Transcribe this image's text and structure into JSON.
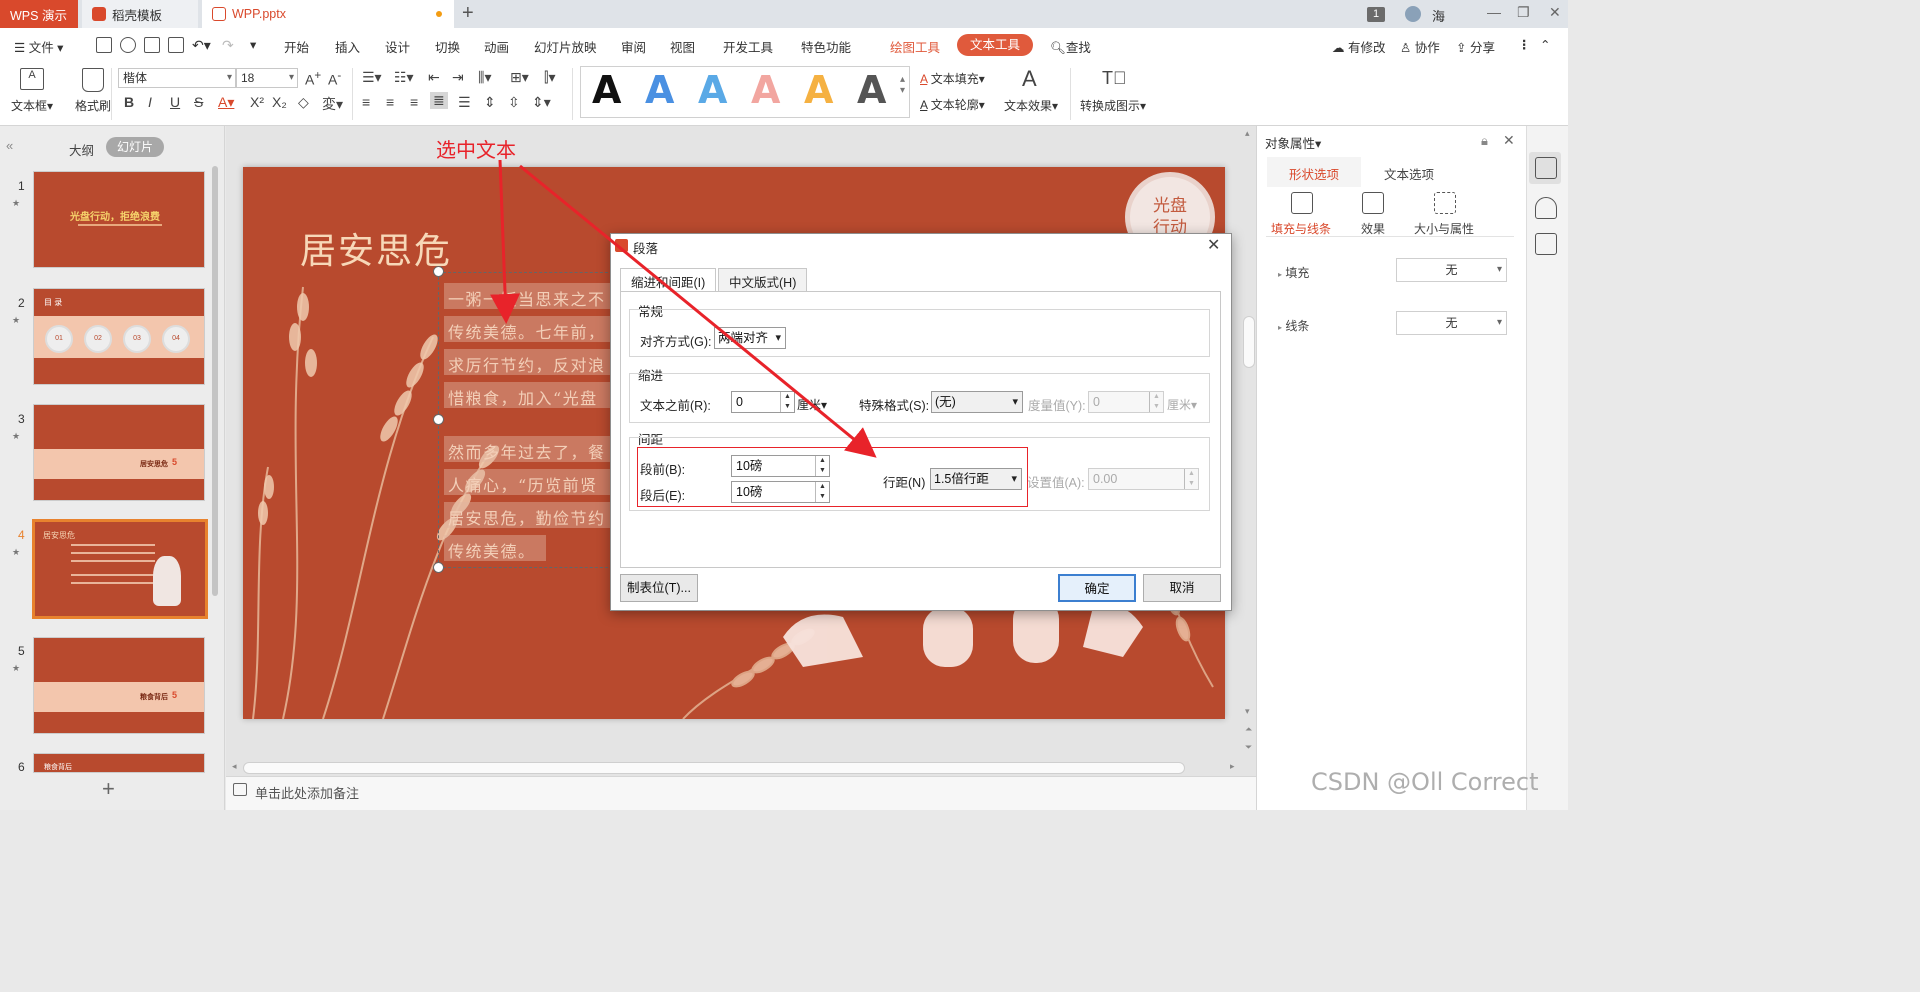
{
  "titlebar": {
    "tabs": [
      {
        "label": "WPS 演示"
      },
      {
        "label": "稻壳模板"
      },
      {
        "label": "WPP.pptx"
      }
    ],
    "plus": "+",
    "window_count": "1",
    "user_name": "海"
  },
  "menubar": {
    "file": "文件",
    "items": [
      "开始",
      "插入",
      "设计",
      "切换",
      "动画",
      "幻灯片放映",
      "审阅",
      "视图",
      "开发工具",
      "特色功能"
    ],
    "drawing_tools": "绘图工具",
    "text_tools": "文本工具",
    "search": "查找",
    "right": [
      "有修改",
      "协作",
      "分享"
    ]
  },
  "ribbon": {
    "textbox": "文本框",
    "format_painter": "格式刷",
    "font_name": "楷体",
    "font_size": "18",
    "text_fill": "文本填充",
    "text_outline": "文本轮廓",
    "text_effect": "文本效果",
    "convert": "转换成图示",
    "style_colors": [
      "#111111",
      "#4a90e2",
      "#5aa9e6",
      "#f2a6a0",
      "#f5b142",
      "#555555"
    ]
  },
  "leftpanel": {
    "outline": "大纲",
    "slides": "幻灯片",
    "slide_numbers": [
      "1",
      "2",
      "3",
      "4",
      "5",
      "6"
    ],
    "thumbs": {
      "s1_title": "光盘行动，拒绝浪费",
      "s2_title": "目 录",
      "s2_circles": [
        "01",
        "02",
        "03",
        "04"
      ],
      "s3_title": "居安思危",
      "s4_title": "居安思危",
      "s5_title": "粮食背后",
      "s6_title": "粮食背后",
      "section_num": "5"
    }
  },
  "slide": {
    "title": "居安思危",
    "badge": [
      "光盘",
      "行动"
    ],
    "lines": [
      "一粥一饭当思来之不",
      "传统美德。七年前，",
      "求厉行节约，反对浪",
      "惜粮食，加入“光盘",
      "然而多年过去了，餐",
      "人痛心，“历览前贤",
      "居安思危，勤俭节约",
      "传统美德。"
    ]
  },
  "annotation": {
    "text": "选中文本",
    "color": "#e8232a"
  },
  "dialog": {
    "title": "段落",
    "tabs": [
      "缩进和间距(I)",
      "中文版式(H)"
    ],
    "general": {
      "title": "常规",
      "align_label": "对齐方式(G):",
      "align_value": "两端对齐"
    },
    "indent": {
      "title": "缩进",
      "before_label": "文本之前(R):",
      "before_value": "0",
      "before_unit": "厘米",
      "special_label": "特殊格式(S):",
      "special_value": "(无)",
      "measure_label": "度量值(Y):",
      "measure_value": "0",
      "measure_unit": "厘米"
    },
    "spacing": {
      "title": "间距",
      "before_label": "段前(B):",
      "before_value": "10磅",
      "after_label": "段后(E):",
      "after_value": "10磅",
      "line_label": "行距(N)",
      "line_value": "1.5倍行距",
      "setting_label": "设置值(A):",
      "setting_value": "0.00"
    },
    "tabs_button": "制表位(T)...",
    "ok": "确定",
    "cancel": "取消"
  },
  "rightpanel": {
    "title": "对象属性",
    "tabs": [
      "形状选项",
      "文本选项"
    ],
    "subtabs": [
      "填充与线条",
      "效果",
      "大小与属性"
    ],
    "fill_label": "填充",
    "fill_value": "无",
    "line_label": "线条",
    "line_value": "无"
  },
  "status": {
    "notes": "单击此处添加备注"
  },
  "watermark": "CSDN @Oll Correct"
}
